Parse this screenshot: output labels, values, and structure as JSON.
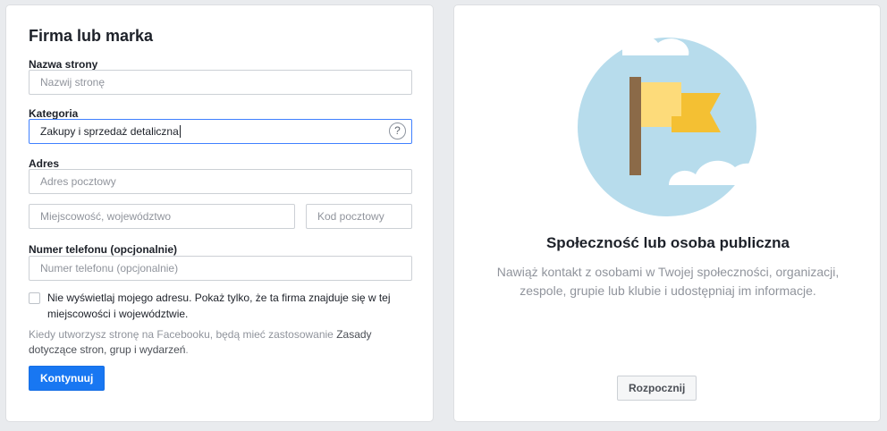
{
  "left": {
    "title": "Firma lub marka",
    "page_name": {
      "label": "Nazwa strony",
      "placeholder": "Nazwij stronę",
      "value": ""
    },
    "category": {
      "label": "Kategoria",
      "value": "Zakupy i sprzedaż detaliczna",
      "help": "?"
    },
    "address": {
      "label": "Adres",
      "street_placeholder": "Adres pocztowy",
      "city_placeholder": "Miejscowość, województwo",
      "zip_placeholder": "Kod pocztowy"
    },
    "phone": {
      "label": "Numer telefonu (opcjonalnie)",
      "placeholder": "Numer telefonu (opcjonalnie)"
    },
    "hide_address": {
      "checked": false,
      "text": "Nie wyświetlaj mojego adresu. Pokaż tylko, że ta firma znajduje się w tej miejscowości i województwie."
    },
    "terms": {
      "prefix": "Kiedy utworzysz stronę na Facebooku, będą mieć zastosowanie ",
      "link": "Zasady dotyczące stron, grup i wydarzeń",
      "suffix": "."
    },
    "continue_label": "Kontynuuj"
  },
  "right": {
    "title": "Społeczność lub osoba publiczna",
    "description": "Nawiąż kontakt z osobami w Twojej społeczności, organizacji, zespole, grupie lub klubie i udostępniaj im informacje.",
    "start_label": "Rozpocznij",
    "illustration": "flag-icon"
  },
  "colors": {
    "primary": "#1877f2",
    "circle": "#b7dcec",
    "flag_light": "#fddb7a",
    "flag_dark": "#f4c033",
    "pole": "#8b6a48"
  }
}
